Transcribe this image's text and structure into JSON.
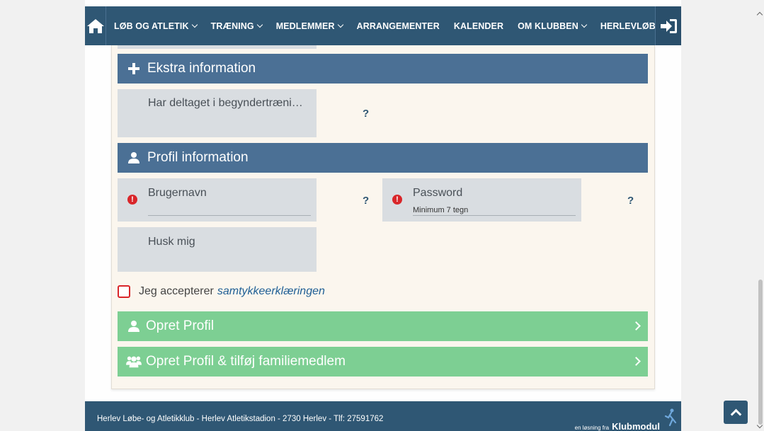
{
  "nav": {
    "items": [
      {
        "label": "LØB OG ATLETIK",
        "dropdown": true
      },
      {
        "label": "TRÆNING",
        "dropdown": true
      },
      {
        "label": "MEDLEMMER",
        "dropdown": true
      },
      {
        "label": "ARRANGEMENTER",
        "dropdown": false
      },
      {
        "label": "KALENDER",
        "dropdown": false
      },
      {
        "label": "OM KLUBBEN",
        "dropdown": true
      },
      {
        "label": "HERLEVLØBET",
        "dropdown": false
      }
    ],
    "home_icon": "home-icon",
    "login_icon": "sign-in-icon"
  },
  "sections": {
    "extra": {
      "title": "Ekstra information",
      "icon": "plus-icon"
    },
    "profile": {
      "title": "Profil information",
      "icon": "user-icon"
    }
  },
  "fields": {
    "beginner": {
      "label": "Har deltaget i begyndertræni…"
    },
    "username": {
      "label": "Brugernavn",
      "value": ""
    },
    "password": {
      "label": "Password",
      "placeholder": "Minimum 7 tegn"
    },
    "remember": {
      "label": "Husk mig"
    },
    "help_text": "?",
    "required_mark": "!"
  },
  "consent": {
    "text": "Jeg accepterer",
    "link": "samtykkeerklæringen",
    "checked": false
  },
  "buttons": {
    "create_profile": "Opret Profil",
    "create_family": "Opret Profil & tilføj familiemedlem"
  },
  "footer": {
    "text": "Herlev Løbe- og Atletikklub - Herlev Atletikstadion - 2730 Herlev - Tlf: 27591762",
    "brand_small": "en løsning fra",
    "brand_big": "Klubmodul"
  },
  "colors": {
    "navy": "#2f5774",
    "section": "#4b7095",
    "green": "#7dcf93",
    "required": "#d9262a"
  }
}
